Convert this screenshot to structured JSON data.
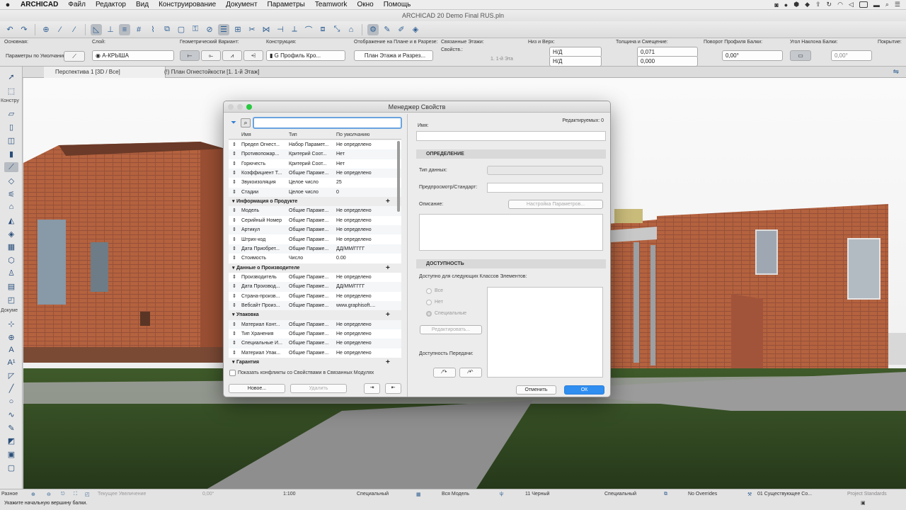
{
  "menubar": {
    "apple": "",
    "app_name": "ARCHICAD",
    "items": [
      "Файл",
      "Редактор",
      "Вид",
      "Конструирование",
      "Документ",
      "Параметры",
      "Teamwork",
      "Окно",
      "Помощь"
    ],
    "time": ""
  },
  "window": {
    "title": "ARCHICAD 20 Demo Final RUS.pln"
  },
  "infobox": {
    "sections": {
      "osnovnaya": "Основная:",
      "sloy": "Слой:",
      "geom": "Геометрический Вариант:",
      "konstr": "Конструкция:",
      "otobr": "Отображение на Плане и в Разрезе:",
      "svyaz": "Связанные Этажи:",
      "niz": "Низ и Верх:",
      "tolsh": "Толщина и Смещение:",
      "povorot": "Поворот Профиля Балки:",
      "ugol": "Угол Наклона Балки:",
      "pokrytie": "Покрытие:"
    },
    "defaults_label": "Параметры по Умолчанию",
    "layer_value": "А-КРЫША",
    "profile_value": "G Профиль Кро...",
    "plan_value": "План Этажа и Разрез...",
    "svoyst": "Свойств.:",
    "floor_value": "1. 1-й Эта",
    "niz1": "Н/Д",
    "niz2": "Н/Д",
    "tolsh1": "0,071",
    "tolsh2": "0,000",
    "povorot_value": "0,00°",
    "ugol_value": "0,00°"
  },
  "tabs": [
    "Перспектива 1 [3D / Все]",
    "(!) План Огнестойкости [1. 1-й Этаж]"
  ],
  "toolbox": {
    "konstr_head": "Констру",
    "doc_head": "Докуме",
    "misc_head": "Разное"
  },
  "dialog": {
    "title": "Менеджер Свойств",
    "columns": [
      "Имя",
      "Тип",
      "По умолчанию"
    ],
    "rows": [
      {
        "name": "Предел Огнест...",
        "type": "Набор Парамет...",
        "def": "Не определено",
        "group": false
      },
      {
        "name": "Противопожар...",
        "type": "Критерий Соот...",
        "def": "Нет",
        "group": false
      },
      {
        "name": "Горючесть",
        "type": "Критерий Соот...",
        "def": "Нет",
        "group": false
      },
      {
        "name": "Коэффициент Т...",
        "type": "Общие Параме...",
        "def": "Не определено",
        "group": false
      },
      {
        "name": "Звукоизоляция",
        "type": "Целое число",
        "def": "25",
        "group": false
      },
      {
        "name": "Стадии",
        "type": "Целое число",
        "def": "0",
        "group": false
      },
      {
        "name": "Информация о Продукте",
        "type": "",
        "def": "",
        "group": true
      },
      {
        "name": "Модель",
        "type": "Общие Параме...",
        "def": "Не определено",
        "group": false
      },
      {
        "name": "Серийный Номер",
        "type": "Общие Параме...",
        "def": "Не определено",
        "group": false
      },
      {
        "name": "Артикул",
        "type": "Общие Параме...",
        "def": "Не определено",
        "group": false
      },
      {
        "name": "Штрих-код",
        "type": "Общие Параме...",
        "def": "Не определено",
        "group": false
      },
      {
        "name": "Дата Приобрет...",
        "type": "Общие Параме...",
        "def": "ДД/ММ/ГГГГ",
        "group": false
      },
      {
        "name": "Стоимость",
        "type": "Число",
        "def": "0.00",
        "group": false
      },
      {
        "name": "Данные о Производителе",
        "type": "",
        "def": "",
        "group": true
      },
      {
        "name": "Производитель",
        "type": "Общие Параме...",
        "def": "Не определено",
        "group": false
      },
      {
        "name": "Дата Производ...",
        "type": "Общие Параме...",
        "def": "ДД/ММ/ГГГГ",
        "group": false
      },
      {
        "name": "Страна-произв...",
        "type": "Общие Параме...",
        "def": "Не определено",
        "group": false
      },
      {
        "name": "Вебсайт Произ...",
        "type": "Общие Параме...",
        "def": "www.graphisoft....",
        "group": false
      },
      {
        "name": "Упаковка",
        "type": "",
        "def": "",
        "group": true
      },
      {
        "name": "Материал Конт...",
        "type": "Общие Параме...",
        "def": "Не определено",
        "group": false
      },
      {
        "name": "Тип Хранения",
        "type": "Общие Параме...",
        "def": "Не определено",
        "group": false
      },
      {
        "name": "Специальные И...",
        "type": "Общие Параме...",
        "def": "Не определено",
        "group": false
      },
      {
        "name": "Материал Упак...",
        "type": "Общие Параме...",
        "def": "Не определено",
        "group": false
      },
      {
        "name": "Гарантия",
        "type": "",
        "def": "",
        "group": true
      }
    ],
    "conflicts_label": "Показать конфликты со Свойствами в Связанных Модулях",
    "new_btn": "Новое...",
    "delete_btn": "Удалить",
    "editable_count": "Редактируемых: 0",
    "name_label": "Имя:",
    "def_section": "ОПРЕДЕЛЕНИЕ",
    "datatype_label": "Тип данных:",
    "preview_label": "Предпросмотр/Стандарт:",
    "desc_label": "Описание:",
    "settings_btn": "Настройка Параметров...",
    "access_section": "ДОСТУПНОСТЬ",
    "access_label": "Доступно для следующих Классов Элементов:",
    "radio_all": "Все",
    "radio_none": "Нет",
    "radio_special": "Специальные",
    "edit_btn": "Редактировать...",
    "transfer_label": "Доступность Передачи:",
    "cancel_btn": "Отменить",
    "ok_btn": "ОК",
    "accent": "#2f8ef0"
  },
  "statusbar": {
    "misc": "Разное",
    "zoom_label": "Текущее Увеличение",
    "angle": "0,00°",
    "scale": "1:100",
    "model_view": "Специальный",
    "all_model": "Вся Модель",
    "pen": "11 Черный",
    "special2": "Специальный",
    "overrides": "No Overrides",
    "renovation": "01 Существующее Со...",
    "standards": "Project Standards",
    "hint": "Укажите начальную вершину балки."
  }
}
